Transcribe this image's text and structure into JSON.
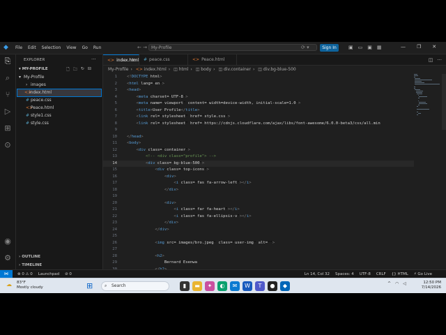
{
  "titlebar": {
    "menus": [
      "File",
      "Edit",
      "Selection",
      "View",
      "Go",
      "Run"
    ],
    "search_text": "My-Profile",
    "signin": "Sign In"
  },
  "sidebar": {
    "title": "EXPLORER",
    "root": "MY-PROFILE",
    "items": [
      {
        "label": "My-Profile",
        "icon": "chevron-down-icon",
        "indent": 0
      },
      {
        "label": "images",
        "icon": "chevron-right-icon",
        "indent": 1
      },
      {
        "label": "index.html",
        "icon": "html-file-icon",
        "indent": 1,
        "active": true
      },
      {
        "label": "peace.css",
        "icon": "css-file-icon",
        "indent": 1
      },
      {
        "label": "Peace.html",
        "icon": "html-file-icon",
        "indent": 1
      },
      {
        "label": "style1.css",
        "icon": "css-file-icon",
        "indent": 1
      },
      {
        "label": "style.css",
        "icon": "css-file-icon",
        "indent": 1
      }
    ],
    "outline": "OUTLINE",
    "timeline": "TIMELINE"
  },
  "tabs": [
    {
      "label": "index.html",
      "active": true
    },
    {
      "label": "peace.css",
      "active": false
    },
    {
      "label": "Peace.html",
      "active": false
    }
  ],
  "breadcrumbs": [
    "My-Profile",
    "index.html",
    "html",
    "body",
    "div.container",
    "div.bg-blue-500"
  ],
  "code_lines": [
    {
      "n": "1",
      "text": "<!DOCTYPE html>"
    },
    {
      "n": "2",
      "text": "<html lang=\"en\">"
    },
    {
      "n": "3",
      "text": "<head>"
    },
    {
      "n": "4",
      "text": "    <meta charset=\"UTF-8\">"
    },
    {
      "n": "5",
      "text": "    <meta name=\"viewport\" content=\"width=device-width, initial-scale=1.0\">"
    },
    {
      "n": "6",
      "text": "    <title>User Profile</title>"
    },
    {
      "n": "7",
      "text": "    <link rel=\"stylesheet\" href=\"style.css\">"
    },
    {
      "n": "8",
      "text": "    <link rel=\"stylesheet\" href=\"https://cdnjs.cloudflare.com/ajax/libs/font-awesome/6.0.0-beta3/css/all.min"
    },
    {
      "n": "9",
      "text": ""
    },
    {
      "n": "10",
      "text": "</head>"
    },
    {
      "n": "11",
      "text": "<body>"
    },
    {
      "n": "12",
      "text": "    <div class=\"container\">"
    },
    {
      "n": "13",
      "text": "        <!-- <div class=\"profile\"> -->"
    },
    {
      "n": "14",
      "text": "        <div class=\"bg-blue-500\">"
    },
    {
      "n": "15",
      "text": "            <div class=\"top-icons\">"
    },
    {
      "n": "16",
      "text": "                <div>"
    },
    {
      "n": "17",
      "text": "                    <i class=\"fas fa-arrow-left\"></i>"
    },
    {
      "n": "18",
      "text": "                </div>"
    },
    {
      "n": "19",
      "text": ""
    },
    {
      "n": "20",
      "text": "                <div>"
    },
    {
      "n": "21",
      "text": "                    <i class=\"far fa-heart\"></i>"
    },
    {
      "n": "22",
      "text": "                    <i class=\"fas fa-ellipsis-v\"></i>"
    },
    {
      "n": "23",
      "text": "                </div>"
    },
    {
      "n": "24",
      "text": "            </div>"
    },
    {
      "n": "25",
      "text": ""
    },
    {
      "n": "26",
      "text": "            <img src=\"images/bro.jpeg\" class=\"user-img\" alt=\"\">"
    },
    {
      "n": "27",
      "text": ""
    },
    {
      "n": "28",
      "text": "            <h2>"
    },
    {
      "n": "29",
      "text": "                Bernard Esenwa"
    },
    {
      "n": "30",
      "text": "            </h2>"
    }
  ],
  "statusbar": {
    "left": [
      "⊗ 0 ⚠ 0",
      "Launchpad",
      "⊘ 0"
    ],
    "right": [
      "Ln 14, Col 32",
      "Spaces: 4",
      "UTF-8",
      "CRLF",
      "{} HTML",
      "⚡ Go Live"
    ]
  },
  "taskbar": {
    "temp": "83°F",
    "condition": "Mostly cloudy",
    "search_placeholder": "Search",
    "time": "12:50 PM",
    "date": "7/14/2026"
  }
}
